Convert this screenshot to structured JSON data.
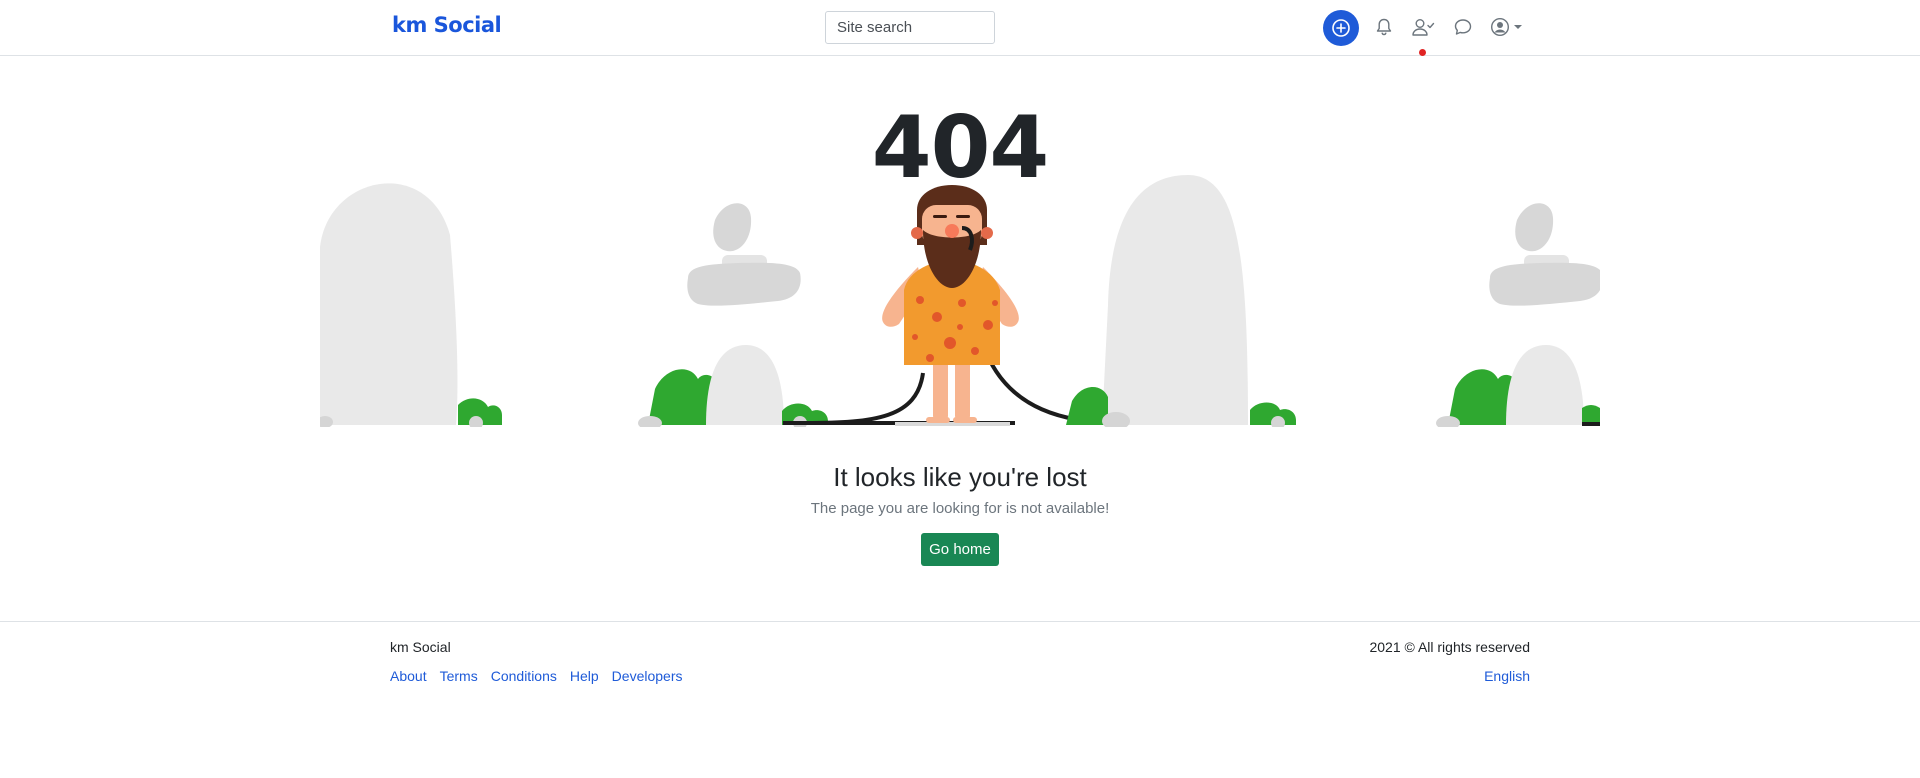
{
  "header": {
    "logo": "km Social",
    "search_placeholder": "Site search",
    "icons": {
      "add": "plus-circle-icon",
      "notifications": "bell-icon",
      "friends": "user-check-icon",
      "messages": "chat-bubble-icon",
      "account": "user-circle-icon",
      "account_caret": "caret-down-icon"
    },
    "has_notification": true
  },
  "error": {
    "code": "404",
    "title": "It looks like you're lost",
    "message": "The page you are looking for is not available!",
    "button_label": "Go home"
  },
  "footer": {
    "brand": "km Social",
    "copyright": "2021 © All rights reserved",
    "links": [
      "About",
      "Terms",
      "Conditions",
      "Help",
      "Developers"
    ],
    "language": "English"
  },
  "colors": {
    "brand": "#1a56db",
    "primary": "#1f5bd8",
    "success": "#198754",
    "notification": "#e02424"
  }
}
